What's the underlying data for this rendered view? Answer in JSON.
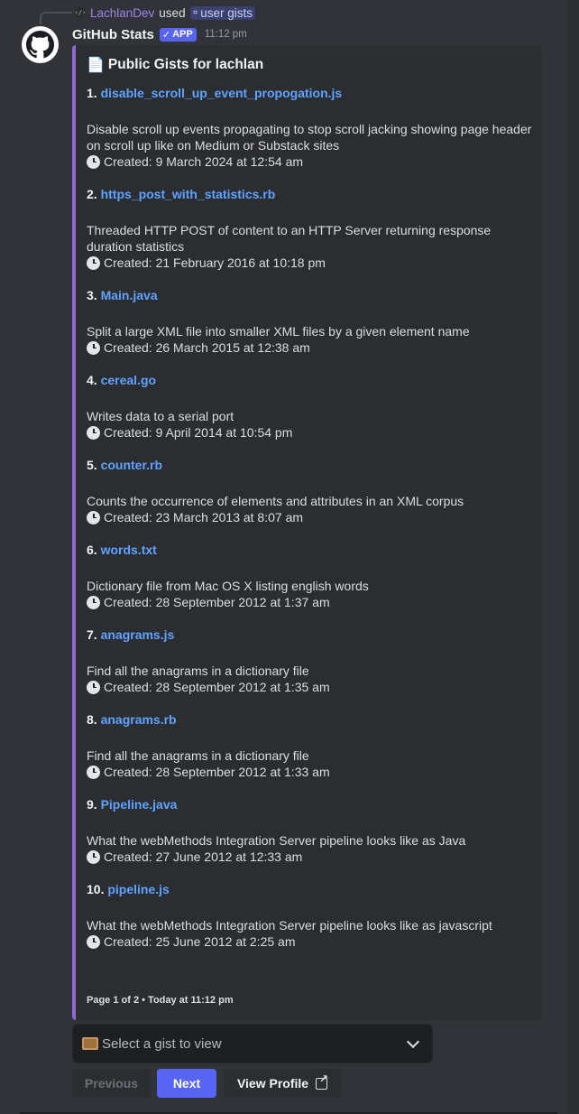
{
  "reply": {
    "avatar_glyph": "‹/›",
    "user": "LachlanDev",
    "used": "used",
    "command": "user gists"
  },
  "message": {
    "bot_name": "GitHub Stats",
    "badge": "APP",
    "time": "11:12 pm"
  },
  "embed": {
    "title": "Public Gists for lachlan",
    "accent_color": "#8e6ad0",
    "gists": [
      {
        "num": "1.",
        "name": "disable_scroll_up_event_propogation.js",
        "description": "Disable scroll up events propagating to stop scroll jacking showing page header on scroll up like on Medium or Substack sites",
        "created": "Created: 9 March 2024 at 12:54 am"
      },
      {
        "num": "2.",
        "name": "https_post_with_statistics.rb",
        "description": "Threaded HTTP POST of content to an HTTP Server returning response duration statistics",
        "created": "Created: 21 February 2016 at 10:18 pm"
      },
      {
        "num": "3.",
        "name": "Main.java",
        "description": "Split a large XML file into smaller XML files by a given element name",
        "created": "Created: 26 March 2015 at 12:38 am"
      },
      {
        "num": "4.",
        "name": "cereal.go",
        "description": "Writes data to a serial port",
        "created": "Created: 9 April 2014 at 10:54 pm"
      },
      {
        "num": "5.",
        "name": "counter.rb",
        "description": "Counts the occurrence of elements and attributes in an XML corpus",
        "created": "Created: 23 March 2013 at 8:07 am"
      },
      {
        "num": "6.",
        "name": "words.txt",
        "description": "Dictionary file from Mac OS X listing english words",
        "created": "Created: 28 September 2012 at 1:37 am"
      },
      {
        "num": "7.",
        "name": "anagrams.js",
        "description": "Find all the anagrams in a dictionary file",
        "created": "Created: 28 September 2012 at 1:35 am"
      },
      {
        "num": "8.",
        "name": "anagrams.rb",
        "description": "Find all the anagrams in a dictionary file",
        "created": "Created: 28 September 2012 at 1:33 am"
      },
      {
        "num": "9.",
        "name": "Pipeline.java",
        "description": "What the webMethods Integration Server pipeline looks like as Java",
        "created": "Created: 27 June 2012 at 12:33 am"
      },
      {
        "num": "10.",
        "name": "pipeline.js",
        "description": "What the webMethods Integration Server pipeline looks like as javascript",
        "created": "Created: 25 June 2012 at 2:25 am"
      }
    ],
    "footer": "Page 1 of 2 • Today at 11:12 pm"
  },
  "select": {
    "placeholder": "Select a gist to view"
  },
  "buttons": {
    "previous": "Previous",
    "next": "Next",
    "view_profile": "View Profile"
  }
}
